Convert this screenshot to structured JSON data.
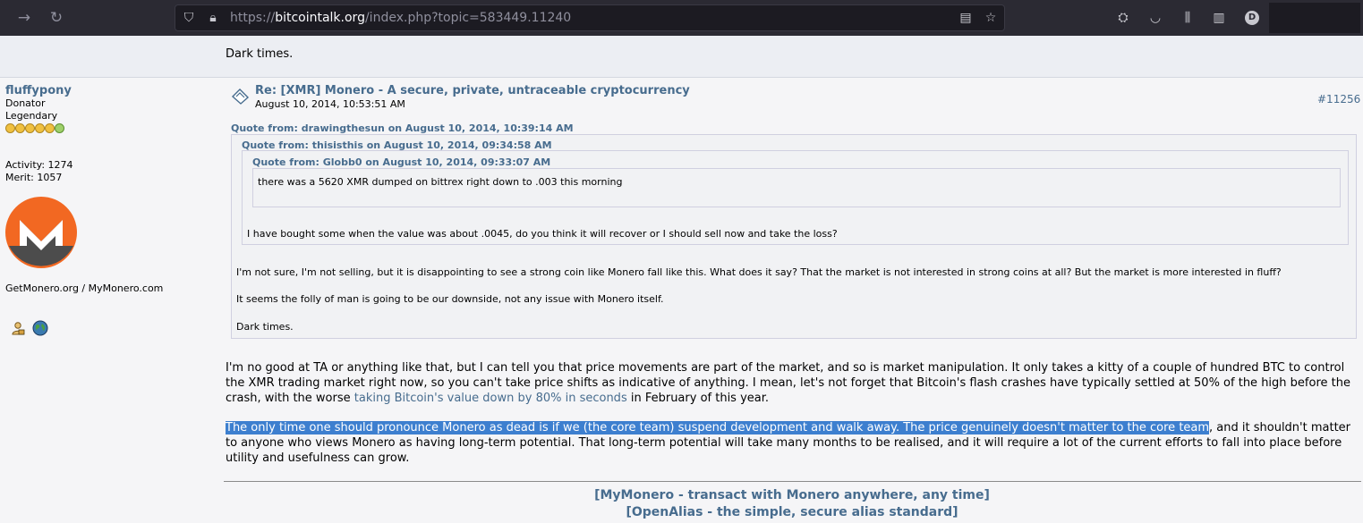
{
  "browser": {
    "url_scheme": "https://",
    "url_host": "bitcointalk.org",
    "url_path": "/index.php?topic=583449.11240",
    "profile_initial": "D"
  },
  "prev_post": {
    "tail_text": "Dark times."
  },
  "poster": {
    "name": "fluffypony",
    "rank1": "Donator",
    "rank2": "Legendary",
    "activity": "Activity: 1274",
    "merit": "Merit: 1057",
    "signature_site": "GetMonero.org / MyMonero.com"
  },
  "post": {
    "subject": "Re: [XMR] Monero - A secure, private, untraceable cryptocurrency",
    "date": "August 10, 2014, 10:53:51 AM",
    "number": "#11256",
    "quote1_header": "Quote from: drawingthesun on August 10, 2014, 10:39:14 AM",
    "quote2_header": "Quote from: thisisthis on August 10, 2014, 09:34:58 AM",
    "quote3_header": "Quote from: Globb0 on August 10, 2014, 09:33:07 AM",
    "quote3_text": "there was a 5620 XMR dumped on bittrex right down to .003 this morning",
    "quote2_text": "I have bought some when the value was about .0045, do you think it will recover or I should sell now and take the loss?",
    "quote1_text_a": "I'm not sure, I'm not selling, but it is disappointing to see a strong coin like Monero fall like this. What does it say? That the market is not interested in strong coins at all? But the market is more interested in fluff?",
    "quote1_text_b": "It seems the folly of man is going to be our downside, not any issue with Monero itself.",
    "quote1_text_c": "Dark times.",
    "para1_a": "I'm no good at TA or anything like that, but I can tell you that price movements are part of the market, and so is market manipulation. It only takes a kitty of a couple of hundred BTC to control the XMR trading market right now, so you can't take price shifts as indicative of anything. I mean, let's not forget that Bitcoin's flash crashes have typically settled at 50% of the high before the crash, with the worse ",
    "para1_link": "taking Bitcoin's value down by 80% in seconds",
    "para1_b": " in February of this year.",
    "para2_selected": "The only time one should pronounce Monero as dead is if we (the core team) suspend development and walk away. The price genuinely doesn't matter to the core team",
    "para2_rest": ", and it shouldn't matter to anyone who views Monero as having long-term potential. That long-term potential will take many months to be realised, and it will require a lot of the current efforts to fall into place before utility and usefulness can grow."
  },
  "signature": {
    "link1": "[MyMonero - transact with Monero anywhere, any time]",
    "link2": "[OpenAlias - the simple, secure alias standard]"
  },
  "colors": {
    "link": "#476c8e",
    "selection": "#3d7fcf",
    "monero_orange": "#f26822",
    "monero_grey": "#4c4c4c"
  }
}
